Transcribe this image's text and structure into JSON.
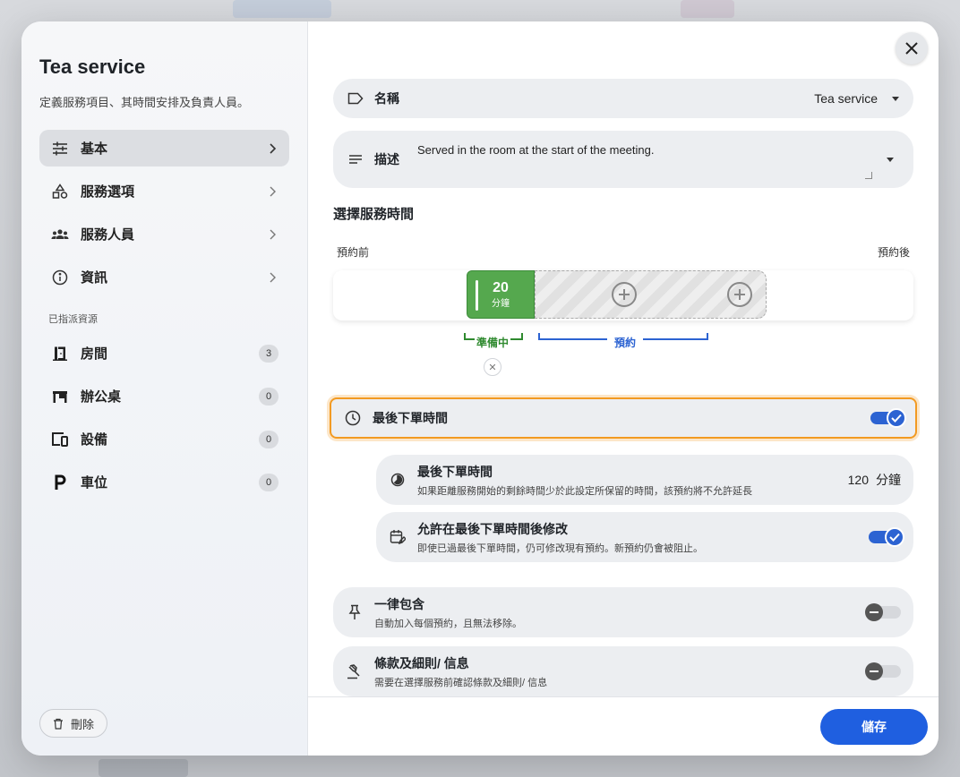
{
  "sidebar": {
    "title": "Tea service",
    "subtitle": "定義服務項目、其時間安排及負責人員。",
    "nav": [
      {
        "label": "基本",
        "icon": "sliders-icon",
        "active": true
      },
      {
        "label": "服務選項",
        "icon": "shapes-icon"
      },
      {
        "label": "服務人員",
        "icon": "people-icon"
      },
      {
        "label": "資訊",
        "icon": "info-icon"
      }
    ],
    "resources_label": "已指派資源",
    "resources": [
      {
        "label": "房間",
        "icon": "door-icon",
        "count": "3"
      },
      {
        "label": "辦公桌",
        "icon": "desk-icon",
        "count": "0"
      },
      {
        "label": "設備",
        "icon": "devices-icon",
        "count": "0"
      },
      {
        "label": "車位",
        "icon": "parking-icon",
        "count": "0"
      }
    ],
    "delete_label": "刪除"
  },
  "form": {
    "name_label": "名稱",
    "name_value": "Tea service",
    "desc_label": "描述",
    "desc_value": "Served in the room at the start of the meeting."
  },
  "timing": {
    "section_title": "選擇服務時間",
    "before_label": "預約前",
    "after_label": "預約後",
    "prep_value": "20",
    "prep_unit": "分鐘",
    "prep_label": "準備中",
    "booking_label": "預約"
  },
  "cutoff": {
    "title": "最後下單時間",
    "enabled": true,
    "rows": [
      {
        "title": "最後下單時間",
        "desc": "如果距離服務開始的剩餘時間少於此設定所保留的時間，該預約將不允許延長",
        "value": "120",
        "unit": "分鐘"
      },
      {
        "title": "允許在最後下單時間後修改",
        "desc": "即使已過最後下單時間，仍可修改現有預約。新預約仍會被阻止。",
        "enabled": true
      }
    ]
  },
  "options": [
    {
      "title": "一律包含",
      "desc": "自動加入每個預約，且無法移除。",
      "enabled": false
    },
    {
      "title": "條款及細則/ 信息",
      "desc": "需要在選擇服務前確認條款及細則/ 信息",
      "enabled": false
    }
  ],
  "footer": {
    "save_label": "儲存"
  },
  "colors": {
    "accent": "#1f5fe0",
    "prep": "#55a84e",
    "highlight": "#f29a22"
  }
}
